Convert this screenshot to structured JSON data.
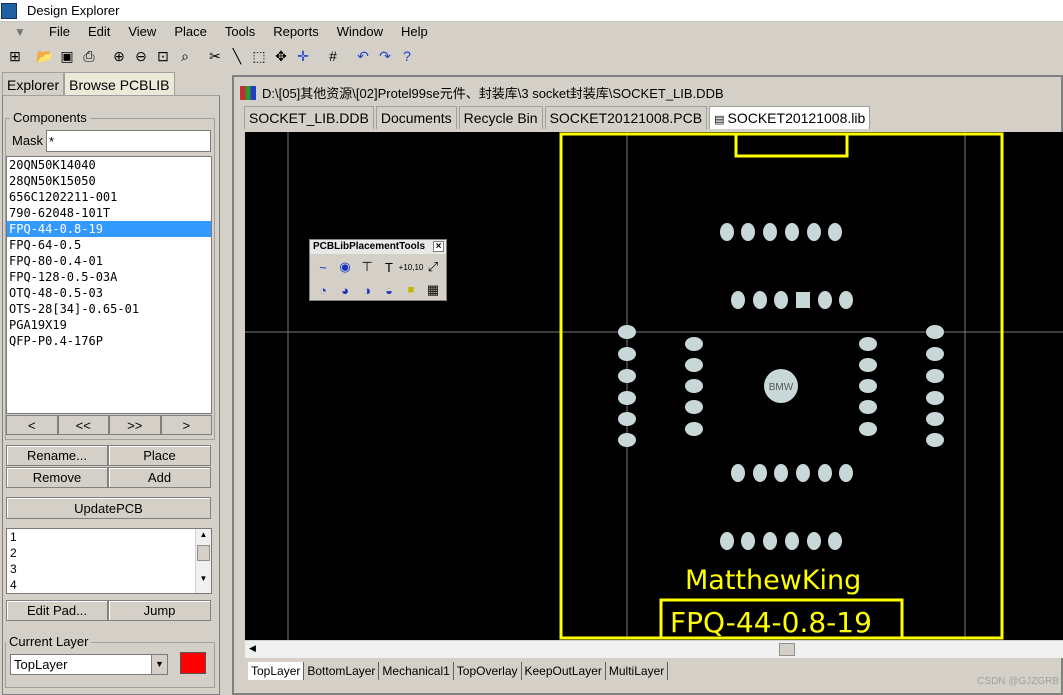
{
  "app": {
    "title": "Design Explorer"
  },
  "menu": [
    "File",
    "Edit",
    "View",
    "Place",
    "Tools",
    "Reports",
    "Window",
    "Help"
  ],
  "toolbar_icons": [
    "explorer-icon",
    "open-icon",
    "save-icon",
    "print-icon",
    "zoom-in-icon",
    "zoom-out-icon",
    "zoom-fit-icon",
    "zoom-area-icon",
    "cut-icon",
    "draw-line-icon",
    "select-icon",
    "move-icon",
    "crosshair-icon",
    "grid-icon",
    "undo-icon",
    "redo-icon",
    "help-icon"
  ],
  "left_panel": {
    "tabs": [
      "Explorer",
      "Browse PCBLIB"
    ],
    "components_label": "Components",
    "mask_label": "Mask",
    "mask_value": "*",
    "components": [
      "20QN50K14040",
      "28QN50K15050",
      "656C1202211-001",
      "790-62048-101T",
      "FPQ-44-0.8-19",
      "FPQ-64-0.5",
      "FPQ-80-0.4-01",
      "FPQ-128-0.5-03A",
      "OTQ-48-0.5-03",
      "OTS-28[34]-0.65-01",
      "PGA19X19",
      "QFP-P0.4-176P"
    ],
    "selected_index": 4,
    "nav": [
      "<",
      "<<",
      ">>",
      ">"
    ],
    "buttons": {
      "rename": "Rename...",
      "place": "Place",
      "remove": "Remove",
      "add": "Add",
      "update": "UpdatePCB",
      "edit_pad": "Edit Pad...",
      "jump": "Jump"
    },
    "pads": [
      "1",
      "2",
      "3",
      "4"
    ],
    "current_layer_label": "Current Layer",
    "current_layer": "TopLayer",
    "layer_color": "#ff0000"
  },
  "document": {
    "path": "D:\\[05]其他资源\\[02]Protel99se元件、封装库\\3 socket封装库\\SOCKET_LIB.DDB",
    "tabs": [
      "SOCKET_LIB.DDB",
      "Documents",
      "Recycle Bin",
      "SOCKET20121008.PCB",
      "SOCKET20121008.lib"
    ],
    "active_tab": 4,
    "layer_tabs": [
      "TopLayer",
      "BottomLayer",
      "Mechanical1",
      "TopOverlay",
      "KeepOutLayer",
      "MultiLayer"
    ],
    "active_layer_tab": 0
  },
  "pcb": {
    "center_pad_label": "BMW",
    "author_text": "MatthewKing",
    "component_name": "FPQ-44-0.8-19",
    "overlay_color": "#ffff00",
    "pad_color": "#c8d8d8",
    "background": "#000000"
  },
  "toolbox": {
    "title": "PCBLibPlacementTools",
    "close": "×",
    "row1": [
      "~",
      "◉",
      "⊤",
      "T",
      "+10,10",
      "⤢"
    ],
    "row2": [
      "◔",
      "◕",
      "◑",
      "◒",
      "■",
      "▦"
    ]
  },
  "watermark": "CSDN @GJZGRB"
}
